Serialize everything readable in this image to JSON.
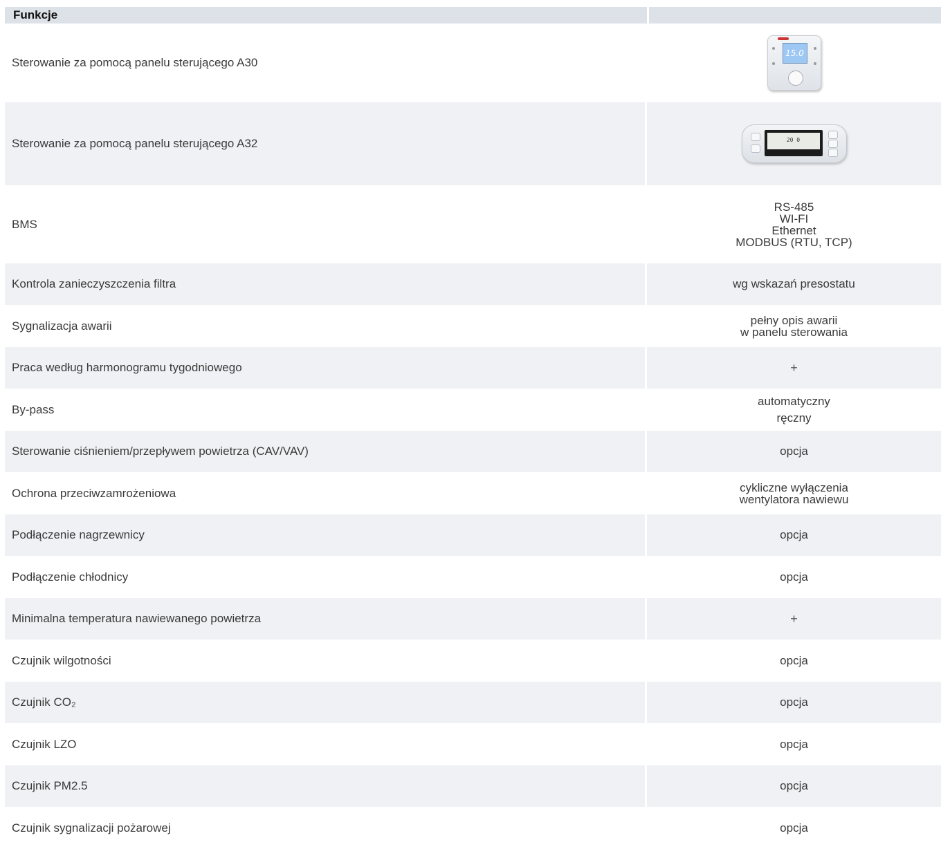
{
  "header": {
    "title": "Funkcje",
    "value": ""
  },
  "a30": {
    "display": "15.0"
  },
  "a32": {
    "display": "20 0"
  },
  "rows": [
    {
      "label": "Sterowanie za pomocą panelu sterującego A30",
      "image": "a30-control-panel"
    },
    {
      "label": "Sterowanie za pomocą panelu sterującego A32",
      "image": "a32-control-panel"
    },
    {
      "label": "BMS",
      "lines": [
        "RS-485",
        "WI-FI",
        "Ethernet",
        "MODBUS (RTU, TCP)"
      ]
    },
    {
      "label": "Kontrola zanieczyszczenia filtra",
      "lines": [
        "wg wskazań presostatu"
      ]
    },
    {
      "label": "Sygnalizacja awarii",
      "lines": [
        "pełny opis awarii",
        "w panelu sterowania"
      ]
    },
    {
      "label": "Praca według harmonogramu tygodniowego",
      "lines": [
        "+"
      ]
    },
    {
      "label": "By-pass",
      "lines": [
        "automatyczny",
        "ręczny"
      ]
    },
    {
      "label": "Sterowanie ciśnieniem/przepływem powietrza (CAV/VAV)",
      "lines": [
        "opcja"
      ]
    },
    {
      "label": "Ochrona przeciwzamrożeniowa",
      "lines": [
        "cykliczne wyłączenia",
        "wentylatora nawiewu"
      ]
    },
    {
      "label": "Podłączenie nagrzewnicy",
      "lines": [
        "opcja"
      ]
    },
    {
      "label": "Podłączenie chłodnicy",
      "lines": [
        "opcja"
      ]
    },
    {
      "label": "Minimalna temperatura nawiewanego powietrza",
      "lines": [
        "+"
      ]
    },
    {
      "label": "Czujnik wilgotności",
      "lines": [
        "opcja"
      ]
    },
    {
      "label": "Czujnik CO₂",
      "lines": [
        "opcja"
      ]
    },
    {
      "label": "Czujnik LZO",
      "lines": [
        "opcja"
      ]
    },
    {
      "label": "Czujnik PM2.5",
      "lines": [
        "opcja"
      ]
    },
    {
      "label": "Czujnik sygnalizacji pożarowej",
      "lines": [
        "opcja"
      ]
    }
  ]
}
